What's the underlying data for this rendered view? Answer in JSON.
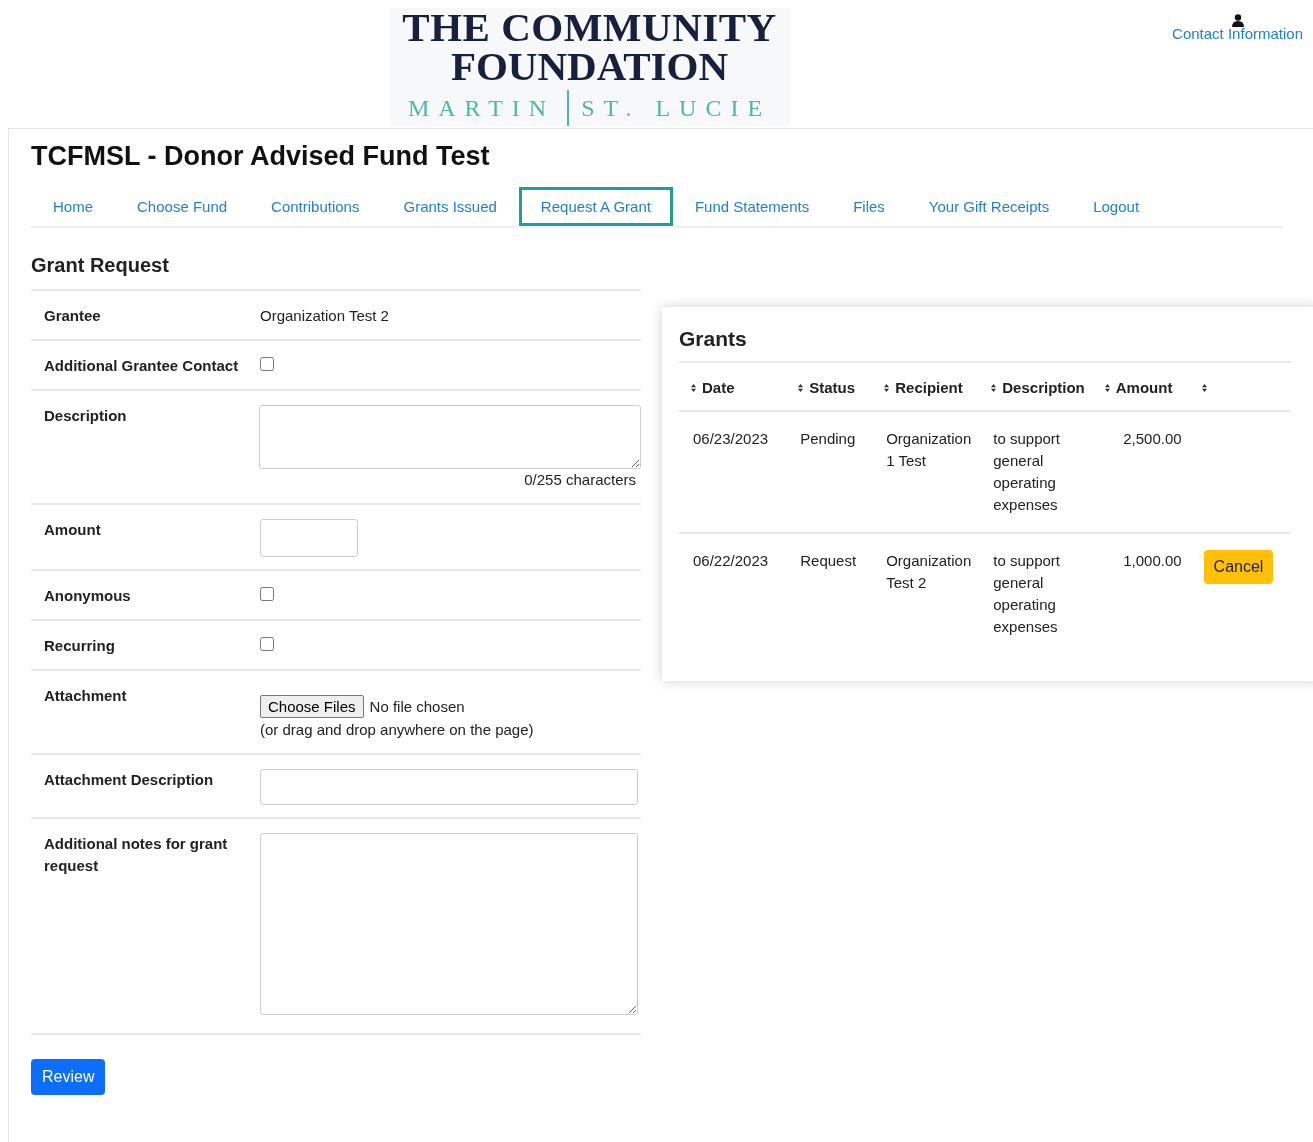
{
  "logo": {
    "line1": "THE COMMUNITY",
    "line2": "FOUNDATION",
    "left": "MARTIN",
    "right": "ST. LUCIE"
  },
  "contact_link": "Contact Information",
  "page_title": "TCFMSL - Donor Advised Fund Test",
  "nav": [
    {
      "label": "Home",
      "selected": false
    },
    {
      "label": "Choose Fund",
      "selected": false
    },
    {
      "label": "Contributions",
      "selected": false
    },
    {
      "label": "Grants Issued",
      "selected": false
    },
    {
      "label": "Request A Grant",
      "selected": true
    },
    {
      "label": "Fund Statements",
      "selected": false
    },
    {
      "label": "Files",
      "selected": false
    },
    {
      "label": "Your Gift Receipts",
      "selected": false
    },
    {
      "label": "Logout",
      "selected": false
    }
  ],
  "form": {
    "title": "Grant Request",
    "rows": [
      {
        "label": "Grantee",
        "kind": "text",
        "value": "Organization Test 2"
      },
      {
        "label": "Additional Grantee Contact",
        "kind": "checkbox",
        "checked": false
      },
      {
        "label": "Description",
        "kind": "textarea",
        "counter": "0/255 characters"
      },
      {
        "label": "Amount",
        "kind": "input"
      },
      {
        "label": "Anonymous",
        "kind": "checkbox",
        "checked": false
      },
      {
        "label": "Recurring",
        "kind": "checkbox",
        "checked": false
      },
      {
        "label": "Attachment",
        "kind": "file",
        "button": "Choose Files",
        "status": "No file chosen",
        "hint": "(or drag and drop anywhere on the page)"
      },
      {
        "label": "Attachment Description",
        "kind": "wide-input"
      },
      {
        "label": "Additional notes for grant request",
        "kind": "notes"
      }
    ]
  },
  "review_button": "Review",
  "grants": {
    "title": "Grants",
    "columns": [
      "Date",
      "Status",
      "Recipient",
      "Description",
      "Amount"
    ],
    "rows": [
      {
        "date": "06/23/2023",
        "status": "Pending",
        "recipient": "Organization 1 Test",
        "description": "to support general operating expenses",
        "amount": "2,500.00"
      },
      {
        "date": "06/22/2023",
        "status": "Request",
        "recipient": "Organization Test 2",
        "description": "to support general operating expenses",
        "amount": "1,000.00",
        "action": "Cancel"
      }
    ]
  }
}
